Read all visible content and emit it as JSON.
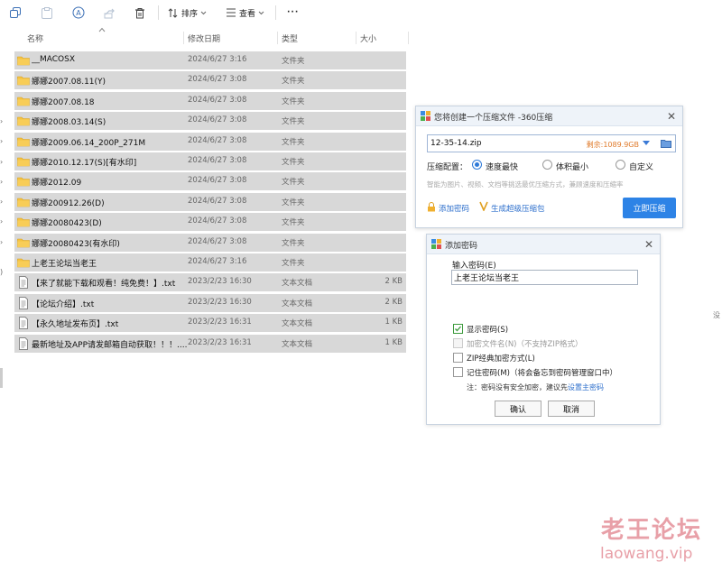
{
  "toolbar": {
    "icons": [
      "copy-icon",
      "paste-icon",
      "rename-icon",
      "share-icon",
      "delete-icon"
    ],
    "sort_label": "排序",
    "view_label": "查看",
    "more_label": "···"
  },
  "columns": {
    "name": "名称",
    "date": "修改日期",
    "type": "类型",
    "size": "大小"
  },
  "files": [
    {
      "name": "__MACOSX",
      "date": "2024/6/27 3:16",
      "type": "文件夹",
      "size": "",
      "icon": "folder-icon"
    },
    {
      "name": "娜娜2007.08.11(Y)",
      "date": "2024/6/27 3:08",
      "type": "文件夹",
      "size": "",
      "icon": "folder-icon"
    },
    {
      "name": "娜娜2007.08.18",
      "date": "2024/6/27 3:08",
      "type": "文件夹",
      "size": "",
      "icon": "folder-icon"
    },
    {
      "name": "娜娜2008.03.14(S)",
      "date": "2024/6/27 3:08",
      "type": "文件夹",
      "size": "",
      "icon": "folder-icon"
    },
    {
      "name": "娜娜2009.06.14_200P_271M",
      "date": "2024/6/27 3:08",
      "type": "文件夹",
      "size": "",
      "icon": "folder-icon"
    },
    {
      "name": "娜娜2010.12.17(S)[有水印]",
      "date": "2024/6/27 3:08",
      "type": "文件夹",
      "size": "",
      "icon": "folder-icon"
    },
    {
      "name": "娜娜2012.09",
      "date": "2024/6/27 3:08",
      "type": "文件夹",
      "size": "",
      "icon": "folder-icon"
    },
    {
      "name": "娜娜200912.26(D)",
      "date": "2024/6/27 3:08",
      "type": "文件夹",
      "size": "",
      "icon": "folder-icon"
    },
    {
      "name": "娜娜20080423(D)",
      "date": "2024/6/27 3:08",
      "type": "文件夹",
      "size": "",
      "icon": "folder-icon"
    },
    {
      "name": "娜娜20080423(有水印)",
      "date": "2024/6/27 3:08",
      "type": "文件夹",
      "size": "",
      "icon": "folder-icon"
    },
    {
      "name": "上老王论坛当老王",
      "date": "2024/6/27 3:16",
      "type": "文件夹",
      "size": "",
      "icon": "folder-icon"
    },
    {
      "name": "【来了就能下载和观看！纯免费！】.txt",
      "date": "2023/2/23 16:30",
      "type": "文本文档",
      "size": "2 KB",
      "icon": "text-file-icon"
    },
    {
      "name": "【论坛介绍】.txt",
      "date": "2023/2/23 16:30",
      "type": "文本文档",
      "size": "2 KB",
      "icon": "text-file-icon"
    },
    {
      "name": "【永久地址发布页】.txt",
      "date": "2023/2/23 16:31",
      "type": "文本文档",
      "size": "1 KB",
      "icon": "text-file-icon"
    },
    {
      "name": "最新地址及APP请发邮箱自动获取！！！....",
      "date": "2023/2/23 16:31",
      "type": "文本文档",
      "size": "1 KB",
      "icon": "text-file-icon"
    }
  ],
  "compress_dialog": {
    "title": "您将创建一个压缩文件 -360压缩",
    "filename": "12-35-14.zip",
    "free_space": "剩余:1089.9GB",
    "config_label": "压缩配置：",
    "options": [
      "速度最快",
      "体积最小",
      "自定义"
    ],
    "selected_option": "速度最快",
    "hint": "智能为图片、视频、文档等挑选最优压缩方式，兼顾速度和压缩率",
    "add_password": "添加密码",
    "self_extract": "生成超级压缩包",
    "start_button": "立即压缩"
  },
  "password_dialog": {
    "title": "添加密码",
    "input_label": "输入密码(E)",
    "password_value": "上老王论坛当老王",
    "checkboxes": [
      {
        "label": "显示密码(S)",
        "checked": true,
        "disabled": false
      },
      {
        "label": "加密文件名(N)（不支持ZIP格式）",
        "checked": false,
        "disabled": true
      },
      {
        "label": "ZIP经典加密方式(L)",
        "checked": false,
        "disabled": false
      },
      {
        "label": "记住密码(M)（将会备忘到密码管理窗口中）",
        "checked": false,
        "disabled": false
      }
    ],
    "note_prefix": "注：密码没有安全加密，建议先",
    "note_link": "设置主密码",
    "ok_button": "确认",
    "cancel_button": "取消"
  },
  "edge_text": "没",
  "watermark": {
    "cn": "老王论坛",
    "en": "laowang.vip"
  },
  "colors": {
    "row_selected": "#d8d8d8",
    "folder": "#f5c242",
    "accent": "#2d83e6",
    "watermark": "#e8a0a8"
  }
}
